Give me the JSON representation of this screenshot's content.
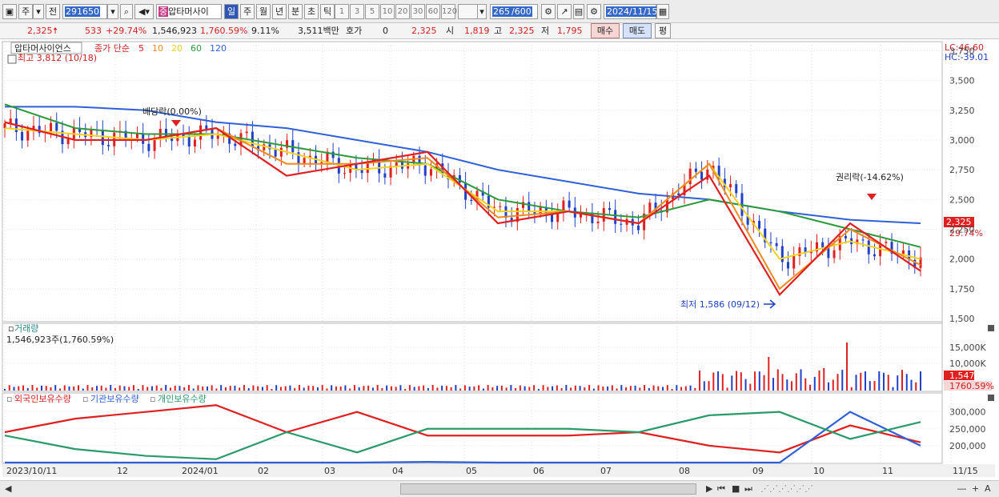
{
  "toolbar": {
    "market_label": "주",
    "market_dropdown": "▾",
    "view_label": "전",
    "stock_code": "291650",
    "stock_tag": "중",
    "stock_name": "압타머사이",
    "periods": [
      "일",
      "주",
      "월",
      "년",
      "분",
      "초",
      "틱"
    ],
    "active_period": "일",
    "intervals": [
      "1",
      "3",
      "5",
      "10",
      "20",
      "30",
      "60",
      "120"
    ],
    "count": "265",
    "count_total": "/600",
    "date": "2024/11/15"
  },
  "infobar": {
    "price": "2,325",
    "change": "533",
    "change_pct": "+29.74%",
    "volume": "1,546,923",
    "volume_pct": "1,760.59%",
    "turnover": "9.11%",
    "amount": "3,511백만",
    "quote_label": "호가",
    "quote_value": "0",
    "quote_price": "2,325",
    "open_label": "시",
    "open": "1,819",
    "high_label": "고",
    "high": "2,325",
    "low_label": "저",
    "low": "1,795",
    "buy_label": "매수",
    "sell_label": "매도",
    "eval_label": "평"
  },
  "price_panel": {
    "stock_label": "압타머사이언스",
    "ma_label": "종가 단순",
    "ma_periods": [
      "5",
      "10",
      "20",
      "60",
      "120"
    ],
    "ma_colors": [
      "#e02020",
      "#f08a1e",
      "#f2d21a",
      "#2a9a3a",
      "#3060d8"
    ],
    "high_note": "최고 3,812 (10/18)",
    "low_note": "최저 1,586 (09/12)",
    "dividend_note": "배당락(0.00%)",
    "rights_note": "권리락(-14.62%)",
    "lc": "LC:46.60",
    "hc": "HC:-39.01",
    "price_tag": "2,325",
    "pct_tag": "29.74%",
    "y_ticks": [
      "3,750",
      "3,500",
      "3,250",
      "3,000",
      "2,750",
      "2,500",
      "2,250",
      "2,000",
      "1,750",
      "1,500"
    ]
  },
  "volume_panel": {
    "title": "거래량",
    "value_text": "1,546,923주(1,760.59%)",
    "y_ticks": [
      "15,000K",
      "10,000K"
    ],
    "vol_tag": "1,547K",
    "vol_pct_tag": "1760.59%"
  },
  "holding_panel": {
    "series_labels": [
      "외국인보유수량",
      "기관보유수량",
      "개인보유수량"
    ],
    "series_colors": [
      "#e02020",
      "#3060d8",
      "#2a9a6a"
    ],
    "y_ticks": [
      "300,000",
      "250,000",
      "200,000"
    ]
  },
  "x_axis": {
    "labels": [
      "2023/10/11",
      "12",
      "2024/01",
      "02",
      "03",
      "04",
      "05",
      "06",
      "07",
      "08",
      "09",
      "10",
      "11",
      "11/15"
    ]
  },
  "chart_data": [
    {
      "type": "line",
      "title": "압타머사이언스 일봉",
      "xlabel": "",
      "ylabel": "",
      "x": [
        "2023/10",
        "2023/11",
        "2023/12",
        "2024/01",
        "2024/02",
        "2024/03",
        "2024/04",
        "2024/05",
        "2024/06",
        "2024/07",
        "2024/08",
        "2024/09",
        "2024/10",
        "2024/11"
      ],
      "ylim": [
        1500,
        3800
      ],
      "series": [
        {
          "name": "5",
          "values": [
            3150,
            3000,
            3000,
            3100,
            2700,
            2800,
            2900,
            2300,
            2400,
            2300,
            2700,
            1700,
            2300,
            1900
          ]
        },
        {
          "name": "10",
          "values": [
            3150,
            3000,
            3000,
            3100,
            2800,
            2800,
            2850,
            2350,
            2400,
            2300,
            2800,
            1750,
            2250,
            1950
          ]
        },
        {
          "name": "20",
          "values": [
            3100,
            3050,
            3000,
            3050,
            2900,
            2750,
            2800,
            2400,
            2400,
            2300,
            2800,
            2000,
            2150,
            2000
          ]
        },
        {
          "name": "60",
          "values": [
            3300,
            3100,
            3050,
            3050,
            2950,
            2850,
            2800,
            2500,
            2400,
            2350,
            2500,
            2400,
            2250,
            2100
          ]
        },
        {
          "name": "120",
          "values": [
            3280,
            3280,
            3250,
            3150,
            3100,
            3000,
            2900,
            2750,
            2650,
            2550,
            2500,
            2400,
            2330,
            2300
          ]
        }
      ]
    },
    {
      "type": "line",
      "title": "보유수량",
      "x": [
        "2023/10",
        "2023/11",
        "2023/12",
        "2024/01",
        "2024/02",
        "2024/03",
        "2024/04",
        "2024/05",
        "2024/06",
        "2024/07",
        "2024/08",
        "2024/09",
        "2024/10",
        "2024/11"
      ],
      "ylim": [
        150000,
        330000
      ],
      "series": [
        {
          "name": "외국인보유수량",
          "values": [
            240000,
            280000,
            300000,
            320000,
            240000,
            300000,
            230000,
            230000,
            230000,
            240000,
            200000,
            180000,
            260000,
            210000
          ]
        },
        {
          "name": "기관보유수량",
          "values": [
            150000,
            150000,
            150000,
            150000,
            150000,
            150000,
            152000,
            150000,
            150000,
            150000,
            150000,
            150000,
            300000,
            200000
          ]
        },
        {
          "name": "개인보유수량",
          "values": [
            230000,
            190000,
            170000,
            160000,
            240000,
            180000,
            250000,
            250000,
            250000,
            240000,
            290000,
            300000,
            220000,
            270000
          ]
        }
      ]
    }
  ]
}
